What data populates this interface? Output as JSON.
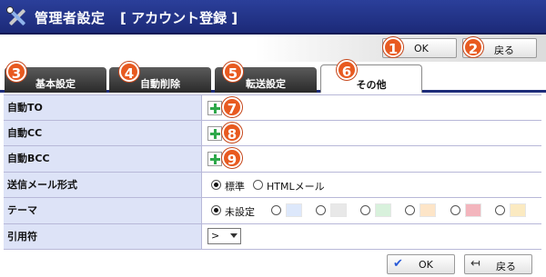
{
  "header": {
    "title": "管理者設定",
    "subtitle": "[ アカウント登録 ]"
  },
  "toolbar": {
    "ok_label": "OK",
    "back_label": "戻る"
  },
  "badges": [
    "1",
    "2",
    "3",
    "4",
    "5",
    "6",
    "7",
    "8",
    "9"
  ],
  "tabs": [
    {
      "label": "基本設定",
      "active": false
    },
    {
      "label": "自動削除",
      "active": false
    },
    {
      "label": "転送設定",
      "active": false
    },
    {
      "label": "その他",
      "active": true
    }
  ],
  "form": {
    "auto_to": {
      "label": "自動TO"
    },
    "auto_cc": {
      "label": "自動CC"
    },
    "auto_bcc": {
      "label": "自動BCC"
    },
    "mail_format": {
      "label": "送信メール形式",
      "options": [
        "標準",
        "HTMLメール"
      ],
      "selected": "標準"
    },
    "theme": {
      "label": "テーマ",
      "first_option": "未設定",
      "swatches": [
        "#dde8fb",
        "#e8e8e8",
        "#d8f1dc",
        "#fde5c8",
        "#f3b5bd",
        "#fbeac1"
      ],
      "selected": "未設定"
    },
    "quote": {
      "label": "引用符",
      "value": ">"
    }
  },
  "footer": {
    "ok_label": "OK",
    "back_label": "戻る"
  },
  "colors": {
    "header": "#1c2a78",
    "label_bg": "#dde3f7",
    "badge": "#e85a20",
    "add": "#2ea84a"
  }
}
